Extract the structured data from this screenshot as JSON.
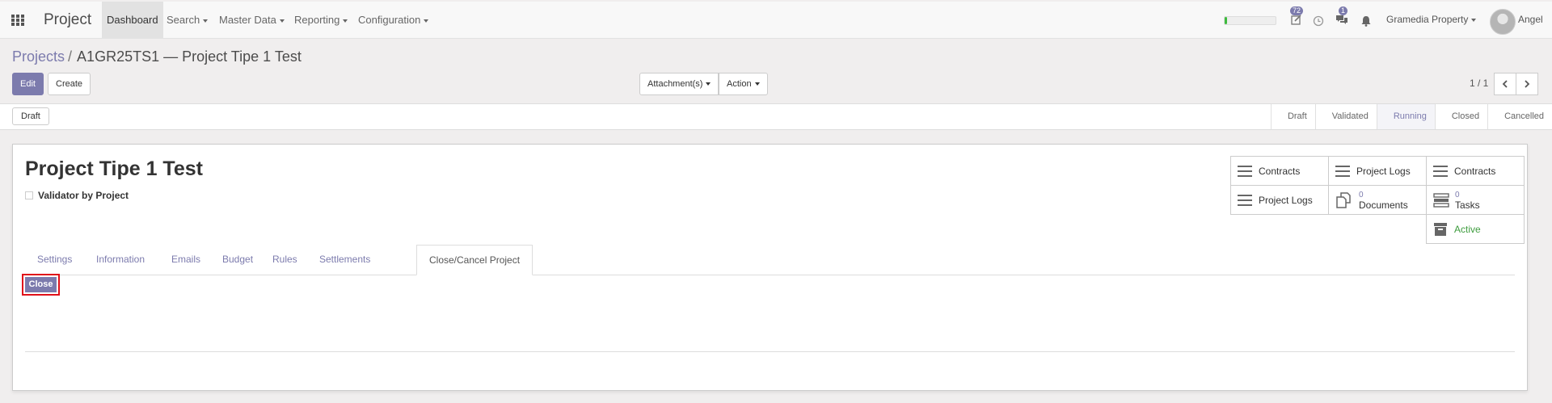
{
  "nav": {
    "app_title": "Project",
    "menu": [
      {
        "label": "Dashboard",
        "active": true
      },
      {
        "label": "Search",
        "dropdown": true
      },
      {
        "label": "Master Data",
        "dropdown": true
      },
      {
        "label": "Reporting",
        "dropdown": true
      },
      {
        "label": "Configuration",
        "dropdown": true
      }
    ],
    "activity_count": "72",
    "messages_count": "1",
    "progress_fraction": 0.05,
    "company": "Gramedia Property",
    "user": "Angel",
    "icons": [
      "apps-icon",
      "activity-icon",
      "clock-icon",
      "chat-icon",
      "bell-icon"
    ]
  },
  "breadcrumb": {
    "parent": "Projects",
    "separator": "/",
    "current": "A1GR25TS1 — Project Tipe 1 Test"
  },
  "controls": {
    "edit": "Edit",
    "create": "Create",
    "attachments": "Attachment(s)",
    "action": "Action",
    "pager": "1 / 1"
  },
  "statusbar": {
    "draft_button": "Draft",
    "stages": [
      "Draft",
      "Validated",
      "Running",
      "Closed",
      "Cancelled"
    ],
    "current_stage": "Running"
  },
  "record": {
    "title": "Project Tipe 1 Test",
    "validator_label": "Validator by Project",
    "validator_checked": false
  },
  "smart_buttons": {
    "contracts_1": "Contracts",
    "project_logs_1": "Project Logs",
    "contracts_2": "Contracts",
    "project_logs_2": "Project Logs",
    "documents_count": "0",
    "documents_label": "Documents",
    "tasks_count": "0",
    "tasks_label": "Tasks",
    "active_label": "Active"
  },
  "tabs": [
    "Settings",
    "Information",
    "Emails",
    "Budget",
    "Rules",
    "Settlements",
    "Close/Cancel Project"
  ],
  "active_tab": "Close/Cancel Project",
  "close_button": "Close",
  "colors": {
    "brand": "#7c7bad",
    "highlight_border": "#e0101a",
    "active_green": "#3e9c3e"
  }
}
